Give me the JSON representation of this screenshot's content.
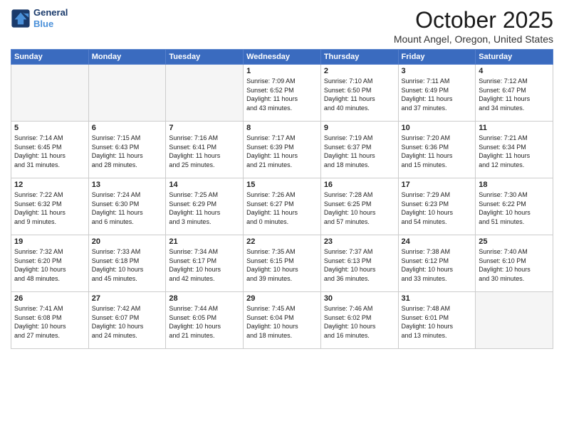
{
  "header": {
    "logo_line1": "General",
    "logo_line2": "Blue",
    "month": "October 2025",
    "location": "Mount Angel, Oregon, United States"
  },
  "days_of_week": [
    "Sunday",
    "Monday",
    "Tuesday",
    "Wednesday",
    "Thursday",
    "Friday",
    "Saturday"
  ],
  "weeks": [
    [
      {
        "day": "",
        "info": ""
      },
      {
        "day": "",
        "info": ""
      },
      {
        "day": "",
        "info": ""
      },
      {
        "day": "1",
        "info": "Sunrise: 7:09 AM\nSunset: 6:52 PM\nDaylight: 11 hours\nand 43 minutes."
      },
      {
        "day": "2",
        "info": "Sunrise: 7:10 AM\nSunset: 6:50 PM\nDaylight: 11 hours\nand 40 minutes."
      },
      {
        "day": "3",
        "info": "Sunrise: 7:11 AM\nSunset: 6:49 PM\nDaylight: 11 hours\nand 37 minutes."
      },
      {
        "day": "4",
        "info": "Sunrise: 7:12 AM\nSunset: 6:47 PM\nDaylight: 11 hours\nand 34 minutes."
      }
    ],
    [
      {
        "day": "5",
        "info": "Sunrise: 7:14 AM\nSunset: 6:45 PM\nDaylight: 11 hours\nand 31 minutes."
      },
      {
        "day": "6",
        "info": "Sunrise: 7:15 AM\nSunset: 6:43 PM\nDaylight: 11 hours\nand 28 minutes."
      },
      {
        "day": "7",
        "info": "Sunrise: 7:16 AM\nSunset: 6:41 PM\nDaylight: 11 hours\nand 25 minutes."
      },
      {
        "day": "8",
        "info": "Sunrise: 7:17 AM\nSunset: 6:39 PM\nDaylight: 11 hours\nand 21 minutes."
      },
      {
        "day": "9",
        "info": "Sunrise: 7:19 AM\nSunset: 6:37 PM\nDaylight: 11 hours\nand 18 minutes."
      },
      {
        "day": "10",
        "info": "Sunrise: 7:20 AM\nSunset: 6:36 PM\nDaylight: 11 hours\nand 15 minutes."
      },
      {
        "day": "11",
        "info": "Sunrise: 7:21 AM\nSunset: 6:34 PM\nDaylight: 11 hours\nand 12 minutes."
      }
    ],
    [
      {
        "day": "12",
        "info": "Sunrise: 7:22 AM\nSunset: 6:32 PM\nDaylight: 11 hours\nand 9 minutes."
      },
      {
        "day": "13",
        "info": "Sunrise: 7:24 AM\nSunset: 6:30 PM\nDaylight: 11 hours\nand 6 minutes."
      },
      {
        "day": "14",
        "info": "Sunrise: 7:25 AM\nSunset: 6:29 PM\nDaylight: 11 hours\nand 3 minutes."
      },
      {
        "day": "15",
        "info": "Sunrise: 7:26 AM\nSunset: 6:27 PM\nDaylight: 11 hours\nand 0 minutes."
      },
      {
        "day": "16",
        "info": "Sunrise: 7:28 AM\nSunset: 6:25 PM\nDaylight: 10 hours\nand 57 minutes."
      },
      {
        "day": "17",
        "info": "Sunrise: 7:29 AM\nSunset: 6:23 PM\nDaylight: 10 hours\nand 54 minutes."
      },
      {
        "day": "18",
        "info": "Sunrise: 7:30 AM\nSunset: 6:22 PM\nDaylight: 10 hours\nand 51 minutes."
      }
    ],
    [
      {
        "day": "19",
        "info": "Sunrise: 7:32 AM\nSunset: 6:20 PM\nDaylight: 10 hours\nand 48 minutes."
      },
      {
        "day": "20",
        "info": "Sunrise: 7:33 AM\nSunset: 6:18 PM\nDaylight: 10 hours\nand 45 minutes."
      },
      {
        "day": "21",
        "info": "Sunrise: 7:34 AM\nSunset: 6:17 PM\nDaylight: 10 hours\nand 42 minutes."
      },
      {
        "day": "22",
        "info": "Sunrise: 7:35 AM\nSunset: 6:15 PM\nDaylight: 10 hours\nand 39 minutes."
      },
      {
        "day": "23",
        "info": "Sunrise: 7:37 AM\nSunset: 6:13 PM\nDaylight: 10 hours\nand 36 minutes."
      },
      {
        "day": "24",
        "info": "Sunrise: 7:38 AM\nSunset: 6:12 PM\nDaylight: 10 hours\nand 33 minutes."
      },
      {
        "day": "25",
        "info": "Sunrise: 7:40 AM\nSunset: 6:10 PM\nDaylight: 10 hours\nand 30 minutes."
      }
    ],
    [
      {
        "day": "26",
        "info": "Sunrise: 7:41 AM\nSunset: 6:08 PM\nDaylight: 10 hours\nand 27 minutes."
      },
      {
        "day": "27",
        "info": "Sunrise: 7:42 AM\nSunset: 6:07 PM\nDaylight: 10 hours\nand 24 minutes."
      },
      {
        "day": "28",
        "info": "Sunrise: 7:44 AM\nSunset: 6:05 PM\nDaylight: 10 hours\nand 21 minutes."
      },
      {
        "day": "29",
        "info": "Sunrise: 7:45 AM\nSunset: 6:04 PM\nDaylight: 10 hours\nand 18 minutes."
      },
      {
        "day": "30",
        "info": "Sunrise: 7:46 AM\nSunset: 6:02 PM\nDaylight: 10 hours\nand 16 minutes."
      },
      {
        "day": "31",
        "info": "Sunrise: 7:48 AM\nSunset: 6:01 PM\nDaylight: 10 hours\nand 13 minutes."
      },
      {
        "day": "",
        "info": ""
      }
    ]
  ]
}
